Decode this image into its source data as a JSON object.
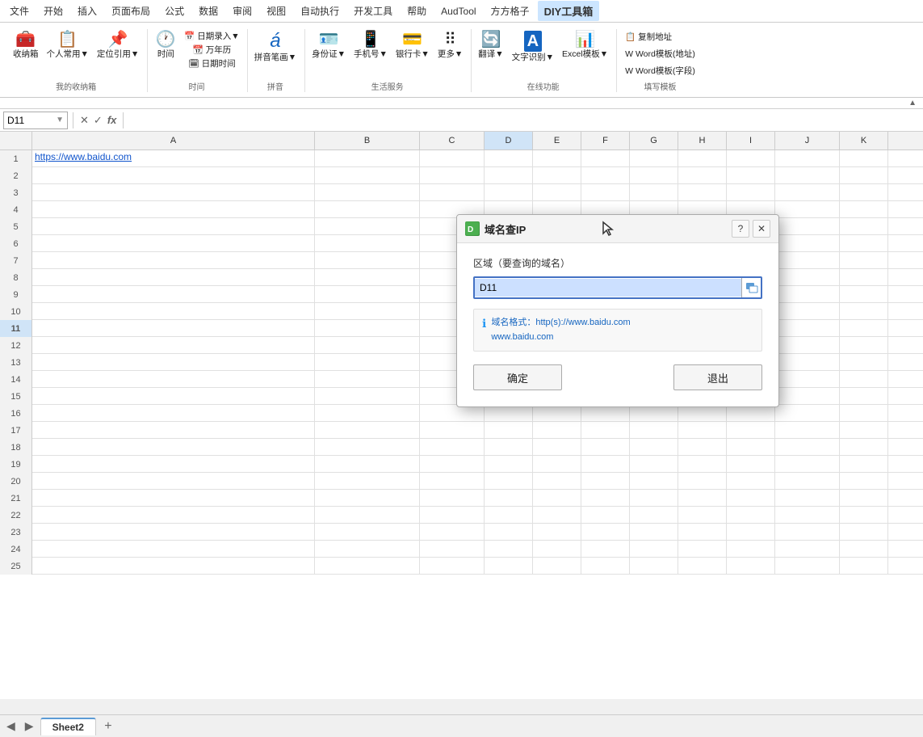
{
  "menubar": {
    "items": [
      "文件",
      "开始",
      "插入",
      "页面布局",
      "公式",
      "数据",
      "审阅",
      "视图",
      "自动执行",
      "开发工具",
      "帮助",
      "AudTool",
      "方方格子",
      "DIY工具箱"
    ]
  },
  "ribbon": {
    "groups": [
      {
        "label": "我的收纳箱",
        "items": [
          {
            "icon": "🧰",
            "label": "收\n纳箱"
          },
          {
            "icon": "📋",
            "label": "个人常\n用▼"
          },
          {
            "icon": "📌",
            "label": "定位引\n用▼"
          }
        ]
      },
      {
        "label": "时间",
        "items": [
          {
            "icon": "🕐",
            "label": "时间"
          },
          {
            "icon": "📅",
            "label": "日期录入▼"
          },
          {
            "icon": "📆",
            "label": "万年历"
          },
          {
            "icon": "🗓",
            "label": "日期时间"
          }
        ]
      },
      {
        "label": "拼音",
        "items": [
          {
            "icon": "á",
            "label": "拼音笔\n画▼"
          }
        ]
      },
      {
        "label": "生活服务",
        "items": [
          {
            "icon": "🪪",
            "label": "身份\n证▼"
          },
          {
            "icon": "📱",
            "label": "手机\n号▼"
          },
          {
            "icon": "🏦",
            "label": "银行\n卡▼"
          },
          {
            "icon": "•••",
            "label": "更多\n▼"
          }
        ]
      },
      {
        "label": "在线功能",
        "items": [
          {
            "icon": "🔄",
            "label": "翻\n译▼"
          },
          {
            "icon": "A",
            "label": "文字识\n别▼"
          },
          {
            "icon": "📊",
            "label": "Excel模\n板▼"
          }
        ]
      },
      {
        "label": "填写模板",
        "items": [
          {
            "icon": "📄",
            "label": "复制地址"
          },
          {
            "icon": "W",
            "label": "Word模板(地址)"
          },
          {
            "icon": "W",
            "label": "Word模板(字段)"
          }
        ]
      }
    ]
  },
  "formula_bar": {
    "cell_ref": "D11",
    "icons": [
      "✕",
      "✓",
      "fx"
    ]
  },
  "spreadsheet": {
    "columns": [
      "A",
      "B",
      "C",
      "D",
      "E",
      "F",
      "G",
      "H",
      "I",
      "J",
      "K"
    ],
    "rows": [
      {
        "num": "1",
        "cells": [
          "https://www.baidu.com",
          "",
          "",
          "",
          "",
          "",
          "",
          "",
          "",
          "",
          ""
        ]
      },
      {
        "num": "2",
        "cells": [
          "",
          "",
          "",
          "",
          "",
          "",
          "",
          "",
          "",
          "",
          ""
        ]
      },
      {
        "num": "3",
        "cells": [
          "",
          "",
          "",
          "",
          "",
          "",
          "",
          "",
          "",
          "",
          ""
        ]
      },
      {
        "num": "4",
        "cells": [
          "",
          "",
          "",
          "",
          "",
          "",
          "",
          "",
          "",
          "",
          ""
        ]
      },
      {
        "num": "5",
        "cells": [
          "",
          "",
          "",
          "",
          "",
          "",
          "",
          "",
          "",
          "",
          ""
        ]
      },
      {
        "num": "6",
        "cells": [
          "",
          "",
          "",
          "",
          "",
          "",
          "",
          "",
          "",
          "",
          ""
        ]
      },
      {
        "num": "7",
        "cells": [
          "",
          "",
          "",
          "",
          "",
          "",
          "",
          "",
          "",
          "",
          ""
        ]
      },
      {
        "num": "8",
        "cells": [
          "",
          "",
          "",
          "",
          "",
          "",
          "",
          "",
          "",
          "",
          ""
        ]
      },
      {
        "num": "9",
        "cells": [
          "",
          "",
          "",
          "",
          "",
          "",
          "",
          "",
          "",
          "",
          ""
        ]
      },
      {
        "num": "10",
        "cells": [
          "",
          "",
          "",
          "",
          "",
          "",
          "",
          "",
          "",
          "",
          ""
        ]
      },
      {
        "num": "11",
        "cells": [
          "",
          "",
          "",
          "",
          "",
          "",
          "",
          "",
          "",
          "",
          ""
        ],
        "selected_col": 3
      },
      {
        "num": "12",
        "cells": [
          "",
          "",
          "",
          "",
          "",
          "",
          "",
          "",
          "",
          "",
          ""
        ]
      },
      {
        "num": "13",
        "cells": [
          "",
          "",
          "",
          "",
          "",
          "",
          "",
          "",
          "",
          "",
          ""
        ]
      },
      {
        "num": "14",
        "cells": [
          "",
          "",
          "",
          "",
          "",
          "",
          "",
          "",
          "",
          "",
          ""
        ]
      },
      {
        "num": "15",
        "cells": [
          "",
          "",
          "",
          "",
          "",
          "",
          "",
          "",
          "",
          "",
          ""
        ]
      },
      {
        "num": "16",
        "cells": [
          "",
          "",
          "",
          "",
          "",
          "",
          "",
          "",
          "",
          "",
          ""
        ]
      },
      {
        "num": "17",
        "cells": [
          "",
          "",
          "",
          "",
          "",
          "",
          "",
          "",
          "",
          "",
          ""
        ]
      },
      {
        "num": "18",
        "cells": [
          "",
          "",
          "",
          "",
          "",
          "",
          "",
          "",
          "",
          "",
          ""
        ]
      },
      {
        "num": "19",
        "cells": [
          "",
          "",
          "",
          "",
          "",
          "",
          "",
          "",
          "",
          "",
          ""
        ]
      },
      {
        "num": "20",
        "cells": [
          "",
          "",
          "",
          "",
          "",
          "",
          "",
          "",
          "",
          "",
          ""
        ]
      },
      {
        "num": "21",
        "cells": [
          "",
          "",
          "",
          "",
          "",
          "",
          "",
          "",
          "",
          "",
          ""
        ]
      },
      {
        "num": "22",
        "cells": [
          "",
          "",
          "",
          "",
          "",
          "",
          "",
          "",
          "",
          "",
          ""
        ]
      },
      {
        "num": "23",
        "cells": [
          "",
          "",
          "",
          "",
          "",
          "",
          "",
          "",
          "",
          "",
          ""
        ]
      },
      {
        "num": "24",
        "cells": [
          "",
          "",
          "",
          "",
          "",
          "",
          "",
          "",
          "",
          "",
          ""
        ]
      },
      {
        "num": "25",
        "cells": [
          "",
          "",
          "",
          "",
          "",
          "",
          "",
          "",
          "",
          "",
          ""
        ]
      }
    ]
  },
  "sheet_tabs": {
    "tabs": [
      "Sheet2"
    ],
    "active": "Sheet2"
  },
  "dialog": {
    "title": "域名查IP",
    "icon_text": "🟢",
    "field_label": "区域（要查询的域名）",
    "input_value": "D11",
    "info_line1": "域名格式：http(s)://www.baidu.com",
    "info_line2": "www.baidu.com",
    "btn_confirm": "确定",
    "btn_cancel": "退出"
  }
}
